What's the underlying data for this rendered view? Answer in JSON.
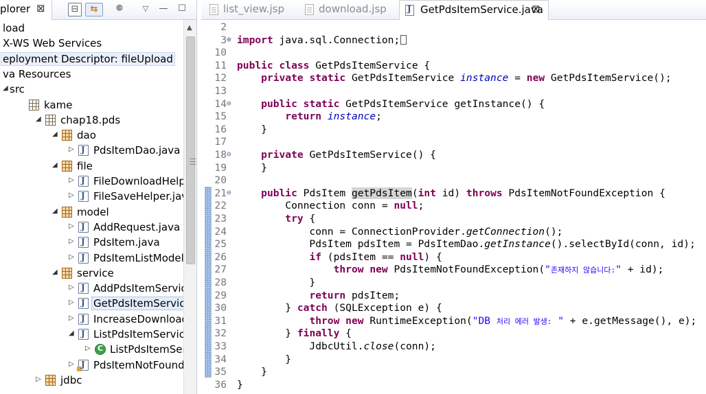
{
  "explorer": {
    "tab_title": "plorer",
    "close_glyph": "⊠",
    "toolbar": {
      "collapse_glyph": "⊟",
      "link_glyph": "⇆",
      "focus_glyph": "⚈",
      "menu_glyph": "▽",
      "minimize_glyph": "—",
      "maximize_glyph": "☐"
    },
    "tree": [
      {
        "label": "load",
        "indent": 0,
        "icon": "none",
        "arrow": ""
      },
      {
        "label": "X-WS Web Services",
        "indent": 0,
        "icon": "none",
        "arrow": ""
      },
      {
        "label": "eployment Descriptor: fileUpload",
        "indent": 0,
        "icon": "none",
        "arrow": "",
        "state": "hl"
      },
      {
        "label": "va Resources",
        "indent": 0,
        "icon": "none",
        "arrow": ""
      },
      {
        "label": "src",
        "indent": 0,
        "icon": "none",
        "arrow": "◢"
      },
      {
        "label": "kame",
        "indent": 1,
        "icon": "package-empty-icon",
        "arrow": ""
      },
      {
        "label": "chap18.pds",
        "indent": 2,
        "icon": "package-empty-icon",
        "arrow": "◢"
      },
      {
        "label": "dao",
        "indent": 3,
        "icon": "package-icon",
        "arrow": "◢"
      },
      {
        "label": "PdsItemDao.java",
        "indent": 4,
        "icon": "java-file-icon",
        "arrow": "▷"
      },
      {
        "label": "file",
        "indent": 3,
        "icon": "package-icon",
        "arrow": "◢"
      },
      {
        "label": "FileDownloadHelper.jav",
        "indent": 4,
        "icon": "java-file-icon",
        "arrow": "▷"
      },
      {
        "label": "FileSaveHelper.java",
        "indent": 4,
        "icon": "java-file-icon",
        "arrow": "▷"
      },
      {
        "label": "model",
        "indent": 3,
        "icon": "package-icon",
        "arrow": "◢"
      },
      {
        "label": "AddRequest.java",
        "indent": 4,
        "icon": "java-file-icon",
        "arrow": "▷"
      },
      {
        "label": "PdsItem.java",
        "indent": 4,
        "icon": "java-file-icon",
        "arrow": "▷"
      },
      {
        "label": "PdsItemListModel.java",
        "indent": 4,
        "icon": "java-file-icon",
        "arrow": "▷"
      },
      {
        "label": "service",
        "indent": 3,
        "icon": "package-icon",
        "arrow": "◢"
      },
      {
        "label": "AddPdsItemService.java",
        "indent": 4,
        "icon": "java-file-icon",
        "arrow": "▷"
      },
      {
        "label": "GetPdsItemService.java",
        "indent": 4,
        "icon": "java-file-icon",
        "arrow": "▷",
        "state": "sel"
      },
      {
        "label": "IncreaseDownloadCoun",
        "indent": 4,
        "icon": "java-file-icon",
        "arrow": "▷"
      },
      {
        "label": "ListPdsItemService.java",
        "indent": 4,
        "icon": "java-file-icon",
        "arrow": "◢"
      },
      {
        "label": "ListPdsItemService",
        "indent": 5,
        "icon": "class-icon",
        "arrow": "▷"
      },
      {
        "label": "PdsItemNotFoundExcep",
        "indent": 4,
        "icon": "java-file-warning-icon",
        "arrow": "▷"
      },
      {
        "label": "jdbc",
        "indent": 2,
        "icon": "package-icon",
        "arrow": "▷"
      }
    ]
  },
  "editor": {
    "tabs": [
      {
        "label": "list_view.jsp"
      },
      {
        "label": "download.jsp"
      },
      {
        "label": "GetPdsItemService.java",
        "active": true
      }
    ],
    "close_glyph": "⊠",
    "lines": [
      {
        "n": "2",
        "html": ""
      },
      {
        "n": "3",
        "fold": "⊕",
        "html": "<span class=\"kw\">import</span> java.sql.Connection;<span class=\"box\"></span>"
      },
      {
        "n": "10",
        "html": ""
      },
      {
        "n": "11",
        "html": "<span class=\"kw\">public</span> <span class=\"kw\">class</span> GetPdsItemService {"
      },
      {
        "n": "12",
        "html": "    <span class=\"kw\">private</span> <span class=\"kw\">static</span> GetPdsItemService <span class=\"fld\">instance</span> = <span class=\"kw\">new</span> GetPdsItemService();"
      },
      {
        "n": "13",
        "html": ""
      },
      {
        "n": "14",
        "fold": "⊖",
        "html": "    <span class=\"kw\">public</span> <span class=\"kw\">static</span> GetPdsItemService getInstance() {"
      },
      {
        "n": "15",
        "html": "        <span class=\"kw\">return</span> <span class=\"fld\">instance</span>;"
      },
      {
        "n": "16",
        "html": "    }"
      },
      {
        "n": "17",
        "html": ""
      },
      {
        "n": "18",
        "fold": "⊖",
        "html": "    <span class=\"kw\">private</span> GetPdsItemService() {"
      },
      {
        "n": "19",
        "html": "    }"
      },
      {
        "n": "20",
        "html": ""
      },
      {
        "n": "21",
        "fold": "⊖",
        "html": "    <span class=\"kw\">public</span> PdsItem <span class=\"mark\">getPdsItem</span>(<span class=\"kw\">int</span> id) <span class=\"kw\">throws</span> PdsItemNotFoundException {"
      },
      {
        "n": "22",
        "html": "        Connection conn = <span class=\"kw\">null</span>;"
      },
      {
        "n": "23",
        "html": "        <span class=\"kw\">try</span> {"
      },
      {
        "n": "24",
        "html": "            conn = ConnectionProvider.<span class=\"ital\">getConnection</span>();"
      },
      {
        "n": "25",
        "html": "            PdsItem pdsItem = PdsItemDao.<span class=\"ital\">getInstance</span>().selectById(conn, id);"
      },
      {
        "n": "26",
        "html": "            <span class=\"kw\">if</span> (pdsItem == <span class=\"kw\">null</span>) {"
      },
      {
        "n": "27",
        "html": "                <span class=\"kw\">throw</span> <span class=\"kw\">new</span> PdsItemNotFoundException(<span class=\"str\">\"<span class=\"kr\">존재하지 않습니다:</span>\"</span> + id);"
      },
      {
        "n": "28",
        "html": "            }"
      },
      {
        "n": "29",
        "html": "            <span class=\"kw\">return</span> pdsItem;"
      },
      {
        "n": "30",
        "html": "        } <span class=\"kw\">catch</span> (SQLException e) {"
      },
      {
        "n": "31",
        "html": "            <span class=\"kw\">throw</span> <span class=\"kw\">new</span> RuntimeException(<span class=\"str\">\"DB <span class=\"kr\">처리 에러 발생:</span> \"</span> + e.getMessage(), e);"
      },
      {
        "n": "32",
        "html": "        } <span class=\"kw\">finally</span> {"
      },
      {
        "n": "33",
        "html": "            JdbcUtil.<span class=\"ital\">close</span>(conn);"
      },
      {
        "n": "34",
        "html": "        }"
      },
      {
        "n": "35",
        "html": "    }"
      },
      {
        "n": "36",
        "html": "}"
      }
    ]
  }
}
